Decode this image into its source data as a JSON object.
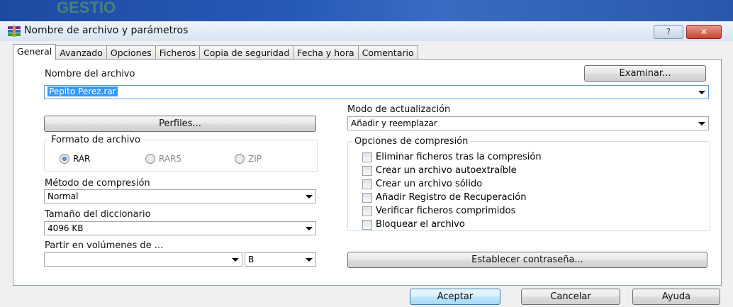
{
  "window": {
    "title": "Nombre de archivo y parámetros",
    "background_text": "GESTIO",
    "help_label": "?",
    "close_label": "✕"
  },
  "tabs": [
    {
      "label": "General",
      "active": true
    },
    {
      "label": "Avanzado"
    },
    {
      "label": "Opciones"
    },
    {
      "label": "Ficheros"
    },
    {
      "label": "Copia de seguridad"
    },
    {
      "label": "Fecha y hora"
    },
    {
      "label": "Comentario"
    }
  ],
  "general": {
    "filename_label": "Nombre del archivo",
    "browse_button": "Examinar...",
    "filename_value": "Pepito Perez.rar",
    "profiles_button": "Perfiles...",
    "update_mode_label": "Modo de actualización",
    "update_mode_value": "Añadir y reemplazar",
    "format_group_label": "Formato de archivo",
    "formats": [
      {
        "label": "RAR",
        "selected": true
      },
      {
        "label": "RAR5",
        "selected": false
      },
      {
        "label": "ZIP",
        "selected": false
      }
    ],
    "method_label": "Método de compresión",
    "method_value": "Normal",
    "dict_label": "Tamaño del diccionario",
    "dict_value": "4096 KB",
    "split_label": "Partir en volúmenes de ...",
    "split_value": "",
    "split_unit": "B",
    "options_group_label": "Opciones de compresión",
    "options": [
      {
        "label": "Eliminar ficheros tras la compresión",
        "checked": false
      },
      {
        "label": "Crear un archivo autoextraíble",
        "checked": false
      },
      {
        "label": "Crear un archivo sólido",
        "checked": false
      },
      {
        "label": "Añadir Registro de Recuperación",
        "checked": false
      },
      {
        "label": "Verificar ficheros comprimidos",
        "checked": false
      },
      {
        "label": "Bloquear el archivo",
        "checked": false
      }
    ],
    "password_button": "Establecer contraseña..."
  },
  "footer": {
    "ok_button": "Aceptar",
    "cancel_button": "Cancelar",
    "help_button": "Ayuda"
  }
}
